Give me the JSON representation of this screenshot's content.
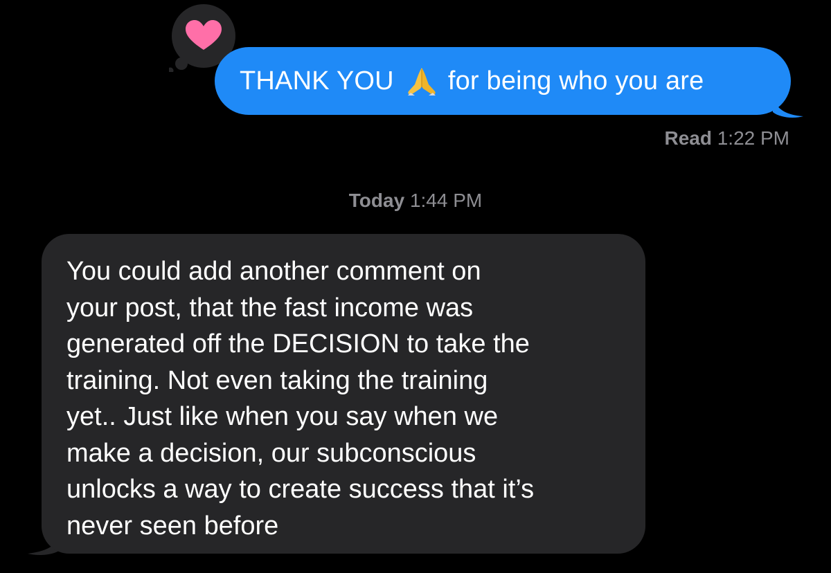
{
  "thread": {
    "outgoing_message": {
      "text_before_emoji": "THANK YOU",
      "emoji": "folded-hands",
      "text_after_emoji": "for being who you are",
      "bubble_color": "#1f8af7",
      "reaction": {
        "icon": "heart-icon",
        "color": "#ff6fa8"
      }
    },
    "read_receipt": {
      "label": "Read",
      "time": "1:22 PM"
    },
    "divider_timestamp": {
      "day": "Today",
      "time": "1:44 PM"
    },
    "incoming_message": {
      "text": "You could add another comment on\nyour post, that the fast income was\ngenerated off the DECISION to take the\ntraining. Not even taking the training\nyet.. Just like when you say when we\nmake a decision, our subconscious\nunlocks a way to create success that it’s\nnever seen before",
      "bubble_color": "#262628"
    }
  }
}
